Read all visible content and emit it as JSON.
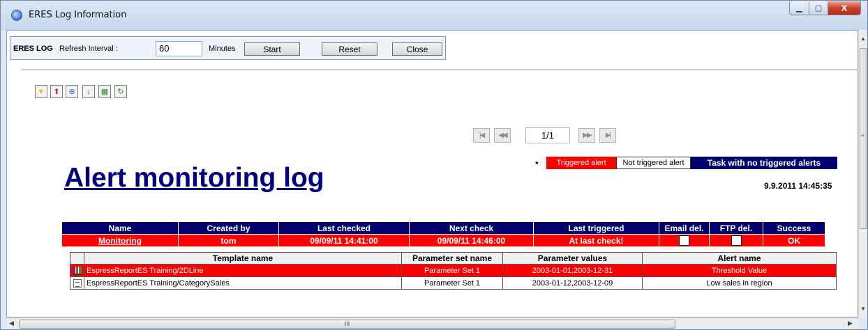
{
  "window": {
    "title": "ERES Log Information",
    "min_glyph": "▁",
    "max_glyph": "▢",
    "close_glyph": "X"
  },
  "toolbar": {
    "brand": "ERES LOG",
    "interval_label": "Refresh Interval :",
    "interval_value": "60",
    "minutes_label": "Minutes",
    "start_label": "Start",
    "reset_label": "Reset",
    "close_label": "Close"
  },
  "icons": {
    "filter": {
      "name": "filter-icon",
      "glyph": "▼",
      "color": "#e8c400"
    },
    "export": {
      "name": "export-icon",
      "glyph": "⬆",
      "color": "#c0392b"
    },
    "zoom": {
      "name": "zoom-icon",
      "glyph": "⊕",
      "color": "#3b6db3"
    },
    "sort": {
      "name": "sort-icon",
      "glyph": "↓",
      "color": "#2b4fa0"
    },
    "table": {
      "name": "table-icon",
      "glyph": "▦",
      "color": "#2a8a3a"
    },
    "refresh": {
      "name": "refresh-icon",
      "glyph": "↻",
      "color": "#2a8a3a"
    }
  },
  "paging": {
    "first": "|◀",
    "prev": "◀◀",
    "page": "1/1",
    "next": "▶▶",
    "last": "▶|"
  },
  "legend": {
    "star": "*",
    "triggered": "Triggered alert",
    "not_triggered": "Not triggered alert",
    "no_trigger_task": "Task with no triggered alerts"
  },
  "report": {
    "title": "Alert monitoring log",
    "date": "9.9.2011 14:45:35"
  },
  "main_table": {
    "headers": [
      "Name",
      "Created by",
      "Last checked",
      "Next check",
      "Last triggered",
      "Email del.",
      "FTP del.",
      "Success"
    ],
    "row": {
      "name": "Monitoring",
      "created_by": "tom",
      "last_checked": "09/09/11 14:41:00",
      "next_check": "09/09/11 14:46:00",
      "last_triggered": "At last check!",
      "success": "OK"
    }
  },
  "detail_table": {
    "headers": [
      "Template name",
      "Parameter set name",
      "Parameter values",
      "Alert name"
    ],
    "rows": [
      {
        "template": "EspressReportES Training/2DLine",
        "param_set": "Parameter Set 1",
        "param_values": "2003-01-01,2003-12-31",
        "alert": "Threshold Value"
      },
      {
        "template": "EspressReportES Training/CategorySales",
        "param_set": "Parameter Set 1",
        "param_values": "2003-01-12,2003-12-09",
        "alert": "Low sales in region"
      }
    ]
  },
  "scrollbars": {
    "up": "▲",
    "down": "▼",
    "left": "◀",
    "right": "▶",
    "v_grip": "≡",
    "h_grip": "III"
  },
  "colors": {
    "triggered_red": "#ff0000",
    "navy": "#00006e",
    "title_blue": "#000080"
  }
}
